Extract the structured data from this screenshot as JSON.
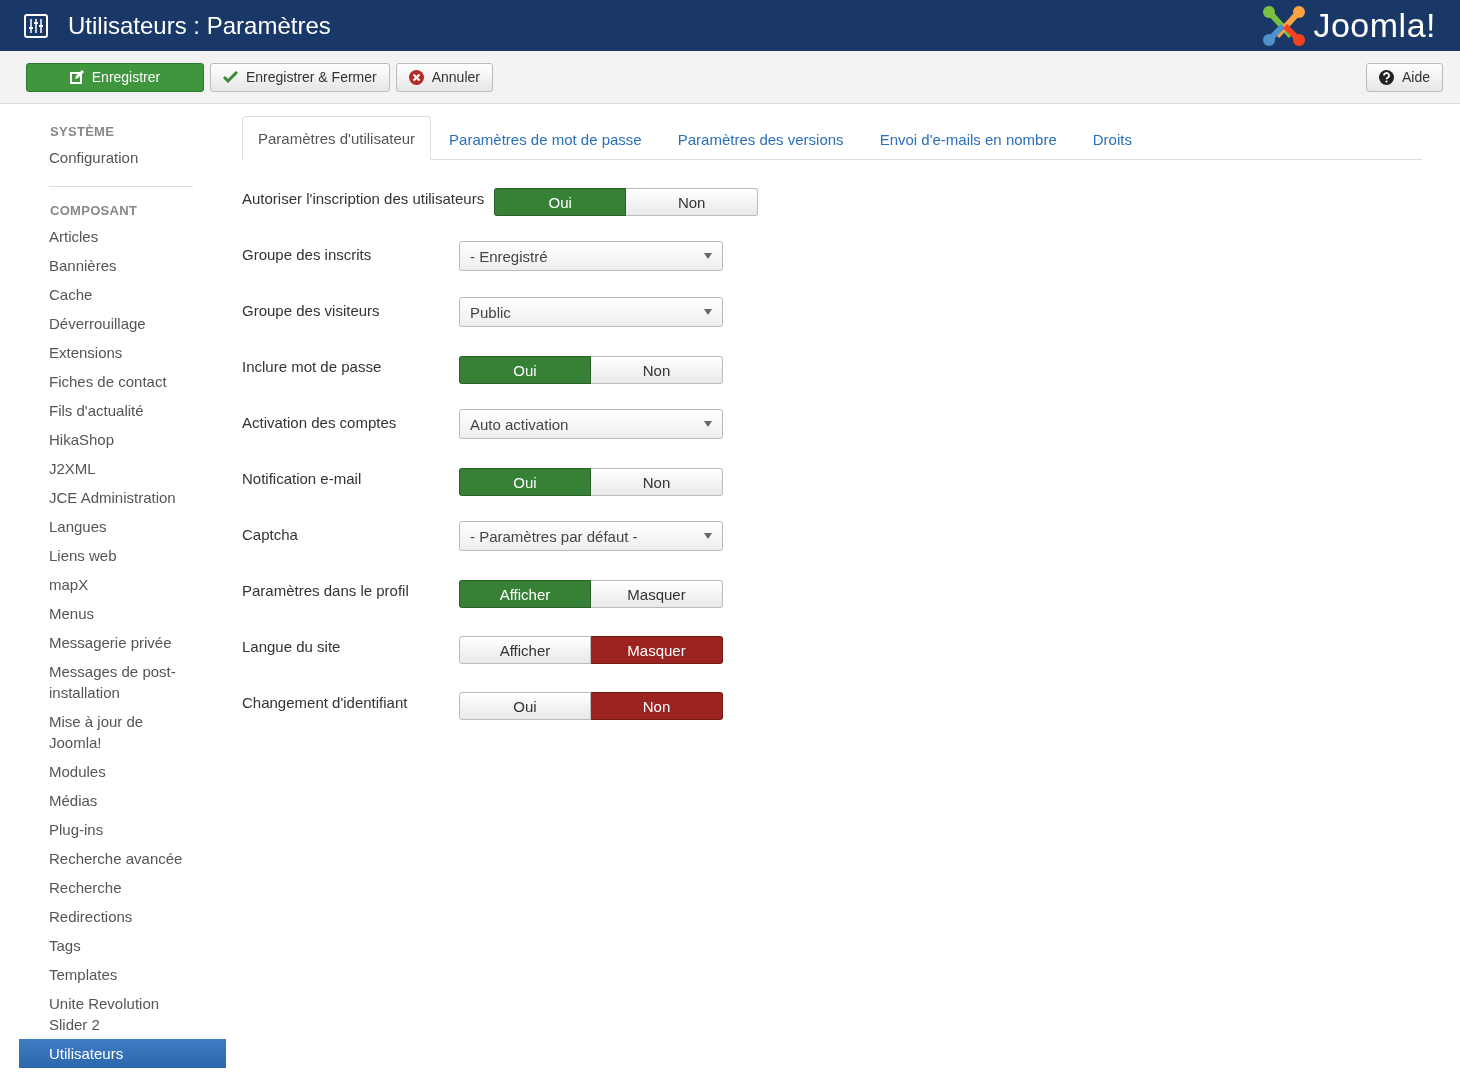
{
  "header": {
    "title": "Utilisateurs : Paramètres",
    "logo_text": "Joomla!"
  },
  "toolbar": {
    "buttons": [
      {
        "label": "Enregistrer",
        "kind": "primary"
      },
      {
        "label": "Enregistrer & Fermer",
        "kind": "check"
      },
      {
        "label": "Annuler",
        "kind": "cancel"
      }
    ],
    "help": {
      "label": "Aide"
    }
  },
  "sidebar": {
    "sections": [
      {
        "heading": "SYSTÈME",
        "items": [
          {
            "label": "Configuration",
            "selected": false
          }
        ]
      },
      {
        "heading": "COMPOSANT",
        "items": [
          {
            "label": "Articles",
            "selected": false
          },
          {
            "label": "Bannières",
            "selected": false
          },
          {
            "label": "Cache",
            "selected": false
          },
          {
            "label": "Déverrouillage",
            "selected": false
          },
          {
            "label": "Extensions",
            "selected": false
          },
          {
            "label": "Fiches de contact",
            "selected": false
          },
          {
            "label": "Fils d'actualité",
            "selected": false
          },
          {
            "label": "HikaShop",
            "selected": false
          },
          {
            "label": "J2XML",
            "selected": false
          },
          {
            "label": "JCE Administration",
            "selected": false
          },
          {
            "label": "Langues",
            "selected": false
          },
          {
            "label": "Liens web",
            "selected": false
          },
          {
            "label": "mapX",
            "selected": false
          },
          {
            "label": "Menus",
            "selected": false
          },
          {
            "label": "Messagerie privée",
            "selected": false
          },
          {
            "label": "Messages de post-installation",
            "selected": false
          },
          {
            "label": "Mise à jour de Joomla!",
            "selected": false
          },
          {
            "label": "Modules",
            "selected": false
          },
          {
            "label": "Médias",
            "selected": false
          },
          {
            "label": "Plug-ins",
            "selected": false
          },
          {
            "label": "Recherche avancée",
            "selected": false
          },
          {
            "label": "Recherche",
            "selected": false
          },
          {
            "label": "Redirections",
            "selected": false
          },
          {
            "label": "Tags",
            "selected": false
          },
          {
            "label": "Templates",
            "selected": false
          },
          {
            "label": "Unite Revolution Slider 2",
            "selected": false
          },
          {
            "label": "Utilisateurs",
            "selected": true
          }
        ]
      }
    ]
  },
  "tabs": [
    {
      "label": "Paramètres d'utilisateur",
      "selected": true
    },
    {
      "label": "Paramètres de mot de passe",
      "selected": false
    },
    {
      "label": "Paramètres des versions",
      "selected": false
    },
    {
      "label": "Envoi d'e-mails en nombre",
      "selected": false
    },
    {
      "label": "Droits",
      "selected": false
    }
  ],
  "fields": [
    {
      "label": "Autoriser l'inscription des utilisateurs",
      "kind": "toggle",
      "color": "#378137",
      "options": [
        {
          "label": "Oui",
          "selected": true
        },
        {
          "label": "Non",
          "selected": false
        }
      ]
    },
    {
      "label": "Groupe des inscrits",
      "kind": "select",
      "value": "- Enregistré"
    },
    {
      "label": "Groupe des visiteurs",
      "kind": "select",
      "value": "Public"
    },
    {
      "label": "Inclure mot de passe",
      "kind": "toggle",
      "color": "#378137",
      "options": [
        {
          "label": "Oui",
          "selected": true
        },
        {
          "label": "Non",
          "selected": false
        }
      ]
    },
    {
      "label": "Activation des comptes",
      "kind": "select",
      "value": "Auto activation"
    },
    {
      "label": "Notification e-mail",
      "kind": "toggle",
      "color": "#378137",
      "options": [
        {
          "label": "Oui",
          "selected": true
        },
        {
          "label": "Non",
          "selected": false
        }
      ]
    },
    {
      "label": "Captcha",
      "kind": "select",
      "value": "- Paramètres par défaut -"
    },
    {
      "label": "Paramètres dans le profil",
      "kind": "toggle",
      "color": "#378137",
      "options": [
        {
          "label": "Afficher",
          "selected": true
        },
        {
          "label": "Masquer",
          "selected": false
        }
      ]
    },
    {
      "label": "Langue du site",
      "kind": "toggle",
      "color": "#9b2420",
      "options": [
        {
          "label": "Afficher",
          "selected": false
        },
        {
          "label": "Masquer",
          "selected": true
        }
      ]
    },
    {
      "label": "Changement d'identifiant",
      "kind": "toggle",
      "color": "#9b2420",
      "options": [
        {
          "label": "Oui",
          "selected": false
        },
        {
          "label": "Non",
          "selected": true
        }
      ]
    }
  ]
}
